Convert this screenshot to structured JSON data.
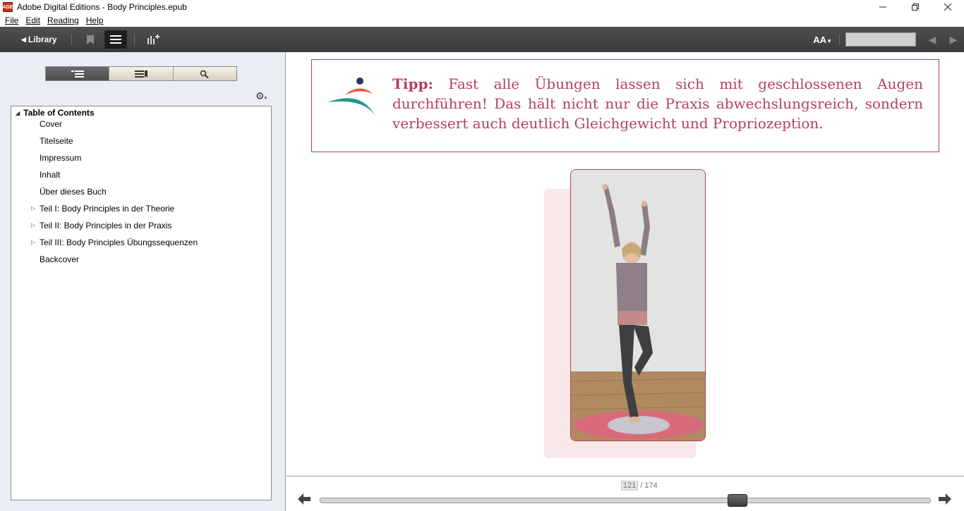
{
  "window": {
    "title": "Adobe Digital Editions - Body Principles.epub",
    "app_icon": "ADE",
    "controls": [
      "minimize-icon",
      "restore-icon",
      "close-icon"
    ]
  },
  "menu": {
    "items": [
      {
        "label": "File"
      },
      {
        "label": "Edit"
      },
      {
        "label": "Reading"
      },
      {
        "label": "Help"
      }
    ]
  },
  "toolbar": {
    "library_label": "Library",
    "icons": [
      "bookmark-icon",
      "contents-list-icon",
      "add-bookmark-icon"
    ],
    "font_size_label": "AA",
    "search_value": ""
  },
  "sidebar": {
    "tabs": [
      "table-of-contents-tab",
      "bookmarks-tab",
      "search-tab"
    ],
    "toc": {
      "heading": "Table of Contents",
      "items": [
        {
          "label": "Cover",
          "expandable": false
        },
        {
          "label": "Titelseite",
          "expandable": false
        },
        {
          "label": "Impressum",
          "expandable": false
        },
        {
          "label": "Inhalt",
          "expandable": false
        },
        {
          "label": "Über dieses Buch",
          "expandable": false
        },
        {
          "label": "Teil I: Body Principles in der Theorie",
          "expandable": true
        },
        {
          "label": "Teil II: Body Principles in der Praxis",
          "expandable": true
        },
        {
          "label": "Teil III: Body Principles Übungssequenzen",
          "expandable": true
        },
        {
          "label": "Backcover",
          "expandable": false
        }
      ]
    }
  },
  "page": {
    "tip_label": "Tipp:",
    "tip_text": "Fast alle Übungen lassen sich mit geschlossenen Augen durchführen! Das hält nicht nur die Praxis abwechslungsreich, sondern verbessert auch deutlich Gleichgewicht und Propriozeption.",
    "accent_color": "#b5405f"
  },
  "navigation": {
    "current_page": "121",
    "separator": "/",
    "total_pages": "174",
    "progress_fraction": 0.69
  }
}
